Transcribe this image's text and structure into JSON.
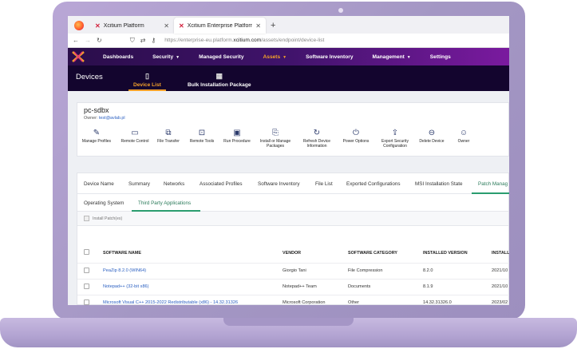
{
  "browser": {
    "tabs": [
      {
        "label": "Xcitium Platform",
        "active": false
      },
      {
        "label": "Xcitium Enterprise Platform",
        "active": true
      }
    ],
    "new_tab": "+",
    "url_prefix": "https://enterprise-eu.platform.",
    "url_domain": "xcitium.com",
    "url_path": "/assets/endpoint/device-list"
  },
  "app_nav": {
    "items": [
      {
        "label": "Dashboards",
        "caret": false,
        "active": false
      },
      {
        "label": "Security",
        "caret": true,
        "active": false
      },
      {
        "label": "Managed Security",
        "caret": false,
        "active": false
      },
      {
        "label": "Assets",
        "caret": true,
        "active": true
      },
      {
        "label": "Software Inventory",
        "caret": false,
        "active": false
      },
      {
        "label": "Management",
        "caret": true,
        "active": false
      },
      {
        "label": "Settings",
        "caret": false,
        "active": false
      }
    ]
  },
  "subnav": {
    "title": "Devices",
    "tabs": [
      {
        "label": "Device List",
        "active": true
      },
      {
        "label": "Bulk Installation Package",
        "active": false
      }
    ]
  },
  "device": {
    "name": "pc-sdbx",
    "owner_label": "Owner:",
    "owner_email": "test@avlab.pl"
  },
  "actions": [
    {
      "label": "Manage Profiles",
      "icon": "profile-edit-icon"
    },
    {
      "label": "Remote Control",
      "icon": "laptop-icon"
    },
    {
      "label": "File Transfer",
      "icon": "file-transfer-icon"
    },
    {
      "label": "Remote Tools",
      "icon": "remote-tools-icon"
    },
    {
      "label": "Run Procedure",
      "icon": "procedure-icon"
    },
    {
      "label": "Install or Manage Packages",
      "icon": "package-icon"
    },
    {
      "label": "Refresh Device Information",
      "icon": "refresh-icon"
    },
    {
      "label": "Power Options",
      "icon": "power-icon"
    },
    {
      "label": "Export Security Configuration",
      "icon": "export-icon"
    },
    {
      "label": "Delete Device",
      "icon": "delete-device-icon"
    },
    {
      "label": "Owner",
      "icon": "owner-icon"
    }
  ],
  "main_tabs": [
    {
      "label": "Device Name"
    },
    {
      "label": "Summary"
    },
    {
      "label": "Networks"
    },
    {
      "label": "Associated Profiles"
    },
    {
      "label": "Software Inventory"
    },
    {
      "label": "File List"
    },
    {
      "label": "Exported Configurations"
    },
    {
      "label": "MSI Installation State"
    },
    {
      "label": "Patch Manag",
      "active": true
    }
  ],
  "sub_tabs": [
    {
      "label": "Operating System"
    },
    {
      "label": "Third Party Applications",
      "active": true
    }
  ],
  "toolbar": {
    "install_patch": "Install Patch(es)"
  },
  "table": {
    "columns": [
      "SOFTWARE NAME",
      "VENDOR",
      "SOFTWARE CATEGORY",
      "INSTALLED VERSION",
      "INSTALL"
    ],
    "rows": [
      [
        "PeaZip 8.2.0 (WIN64)",
        "Giorgio Tani",
        "File Compression",
        "8.2.0",
        "2021/10"
      ],
      [
        "Notepad++ (32-bit x86)",
        "Notepad++ Team",
        "Documents",
        "8.1.9",
        "2021/10"
      ],
      [
        "Microsoft Visual C++ 2015-2022 Redistributable (x86) - 14.32.31326",
        "Microsoft Corporation",
        "Other",
        "14.32.31326.0",
        "2023/02"
      ]
    ]
  },
  "colors": {
    "accent": "#f3a12a",
    "nav_bg": "#2a0d4a",
    "link": "#2a5fc1",
    "tab_active": "#2a9d6f"
  }
}
